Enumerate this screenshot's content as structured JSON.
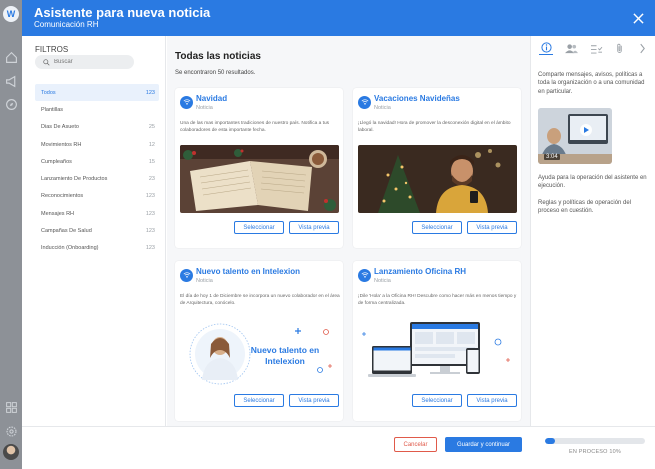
{
  "header": {
    "title": "Asistente para nueva noticia",
    "subtitle": "Comunicación RH"
  },
  "filters": {
    "title": "FILTROS",
    "search_placeholder": "Buscar",
    "items": [
      {
        "label": "Todos",
        "count": "123",
        "active": true
      },
      {
        "label": "Plantillas",
        "count": ""
      },
      {
        "label": "Dias De Asueto",
        "count": "25"
      },
      {
        "label": "Movimientos RH",
        "count": "12"
      },
      {
        "label": "Cumpleaños",
        "count": "15"
      },
      {
        "label": "Lanzamiento De Productos",
        "count": "23"
      },
      {
        "label": "Reconocimientos",
        "count": "123"
      },
      {
        "label": "Mensajes RH",
        "count": "123"
      },
      {
        "label": "Campañas De Salud",
        "count": "123"
      },
      {
        "label": "Inducción (Onboarding)",
        "count": "123"
      }
    ]
  },
  "main": {
    "title": "Todas las noticias",
    "results": "Se encontraron 50 resultados.",
    "cards": [
      {
        "title": "Navidad",
        "type": "Noticia",
        "desc": "Una de las mas importantes tradiciones de nuestro país. Notifica a tus colaboradores de esta importante fecha.",
        "select": "Seleccionar",
        "preview": "Vista previa"
      },
      {
        "title": "Vacaciones Navideñas",
        "type": "Noticia",
        "desc": "¡Llegó la navidad! Hora de promover la desconexión digital en el ámbito laboral.",
        "select": "Seleccionar",
        "preview": "Vista previa"
      },
      {
        "title": "Nuevo talento en Intelexion",
        "type": "Noticia",
        "desc": "El día de hoy 1 de Diciembre se incorpora un nuevo colaborador en el área de Arquitectura, conócelo.",
        "image_text": "Nuevo talento en Intelexion",
        "select": "Seleccionar",
        "preview": "Vista previa"
      },
      {
        "title": "Lanzamiento Oficina RH",
        "type": "Noticia",
        "desc": "¡Dile 'Hola' a la Oficina RH! Descubre como hacer más en menos tiempo y de forma centralizada.",
        "select": "Seleccionar",
        "preview": "Vista previa"
      }
    ]
  },
  "right_panel": {
    "intro": "Comparte mensajes, avisos, políticas a toda la organización o a una comunidad en particular.",
    "video_duration": "3:04",
    "help1": "Ayuda para la operación del asistente en ejecución.",
    "help2": "Reglas y políticas de operación del proceso en cuestión."
  },
  "footer": {
    "cancel": "Cancelar",
    "save": "Guardar y continuar",
    "progress_value": 0.1,
    "progress_label": "EN PROCESO 10%"
  },
  "colors": {
    "primary": "#2a7ae2",
    "danger": "#e05a4a"
  }
}
